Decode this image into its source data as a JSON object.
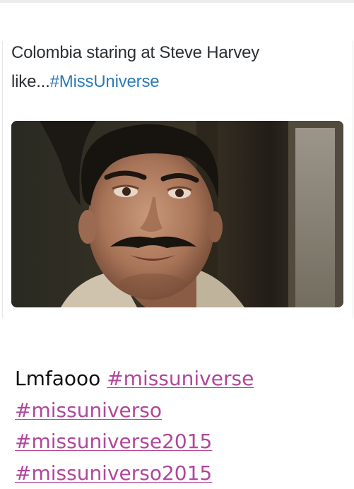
{
  "tweet": {
    "text": "Colombia staring at Steve Harvey like...",
    "hashtag": "#MissUniverse",
    "image_subject": "man-with-mustache-staring"
  },
  "caption": {
    "text": "Lmfaooo",
    "hashtags": [
      "#missuniverse",
      "#missuniverso",
      "#missuniverse2015",
      "#missuniverso2015"
    ]
  },
  "colors": {
    "tweet_hashtag": "#2b7bb9",
    "caption_hashtag": "#b0479b",
    "text": "#111111"
  }
}
